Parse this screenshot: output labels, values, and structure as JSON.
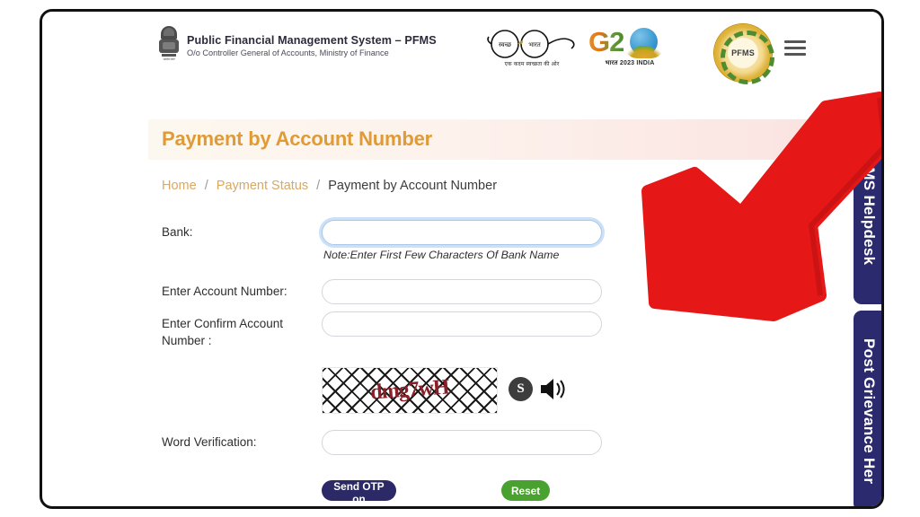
{
  "header": {
    "org_title": "Public Financial Management System – PFMS",
    "org_subtitle": "O/o Controller General of Accounts, Ministry of Finance",
    "emblem_motto": "सत्यमेव जयते",
    "swachh": {
      "left_label": "स्वच्छ",
      "right_label": "भारत",
      "tagline": "एक कदम स्वच्छता की ओर"
    },
    "g20": {
      "text": "G2",
      "sub": "भारत 2023 INDIA"
    },
    "seal": {
      "center": "PFMS"
    },
    "menu_icon": "hamburger-menu-icon"
  },
  "title_band": {
    "title": "Payment by Account Number"
  },
  "breadcrumb": {
    "home": "Home",
    "sep": "/",
    "parent": "Payment Status",
    "current": "Payment by Account Number"
  },
  "form": {
    "bank": {
      "label": "Bank:",
      "value": "",
      "placeholder": "",
      "note": "Note:Enter First Few Characters Of Bank Name"
    },
    "account": {
      "label": "Enter Account Number:",
      "value": "",
      "placeholder": ""
    },
    "confirm": {
      "label": "Enter Confirm Account Number :",
      "value": "",
      "placeholder": ""
    },
    "captcha": {
      "code": "dmg7wH",
      "refresh_icon": "refresh-icon",
      "speaker_icon": "speaker-icon"
    },
    "word_verification": {
      "label": "Word Verification:",
      "value": "",
      "placeholder": ""
    },
    "buttons": {
      "send_otp": "Send OTP on Registered Mobile No",
      "reset": "Reset"
    }
  },
  "side_tabs": {
    "helpdesk": "PFMS Helpdesk",
    "grievance": "Post Grievance Her"
  },
  "annotation": {
    "arrow": "red-arrow-pointing-to-bank-field"
  },
  "colors": {
    "title_orange": "#e09a36",
    "breadcrumb_link": "#d9a863",
    "otp_button": "#2b2a66",
    "reset_button": "#49a12f",
    "side_tab": "#2b2a6e",
    "arrow_red": "#e51717",
    "focus_blue": "#a9c9ea"
  }
}
